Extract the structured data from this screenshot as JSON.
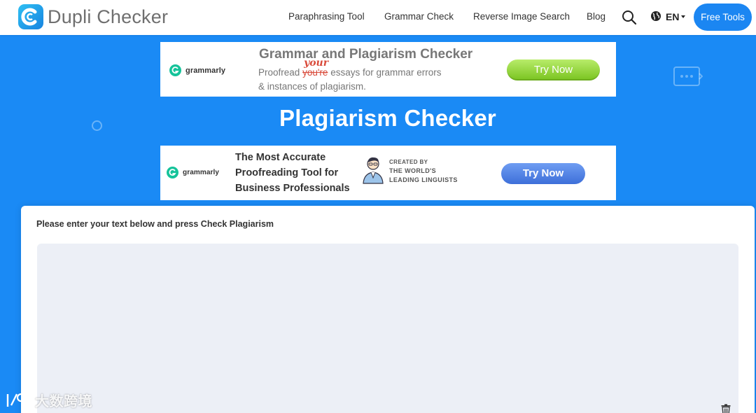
{
  "header": {
    "logo_text": "Dupli Checker",
    "nav": [
      "Paraphrasing Tool",
      "Grammar Check",
      "Reverse Image Search",
      "Blog"
    ],
    "language": "EN",
    "free_tools_label": "Free Tools"
  },
  "ad_top": {
    "brand": "grammarly",
    "title": "Grammar and Plagiarism Checker",
    "body_prefix": "Proofread",
    "body_struck": "you're",
    "body_correction": "your",
    "body_rest": "essays for grammar errors",
    "body_line2": "& instances of plagiarism.",
    "cta": "Try Now",
    "cta_color": "#8fd12f"
  },
  "page": {
    "title": "Plagiarism Checker"
  },
  "ad_bottom": {
    "brand": "grammarly",
    "lines": [
      "The Most Accurate",
      "Proofreading Tool for",
      "Business Professionals"
    ],
    "small_lines": [
      "CREATED BY",
      "THE WORLD'S",
      "LEADING LINGUISTS"
    ],
    "cta": "Try Now",
    "cta_color": "#4c7fe0"
  },
  "checker": {
    "instruction": "Please enter your text below and press Check Plagiarism",
    "text_value": ""
  },
  "watermark": {
    "text": "大数跨境"
  },
  "colors": {
    "brand_blue": "#1a8af5",
    "grammarly_green": "#15c39a"
  },
  "icons": {
    "search": "search-icon",
    "globe": "globe-icon",
    "trash": "trash-icon",
    "chat": "chat-bubble-icon"
  }
}
